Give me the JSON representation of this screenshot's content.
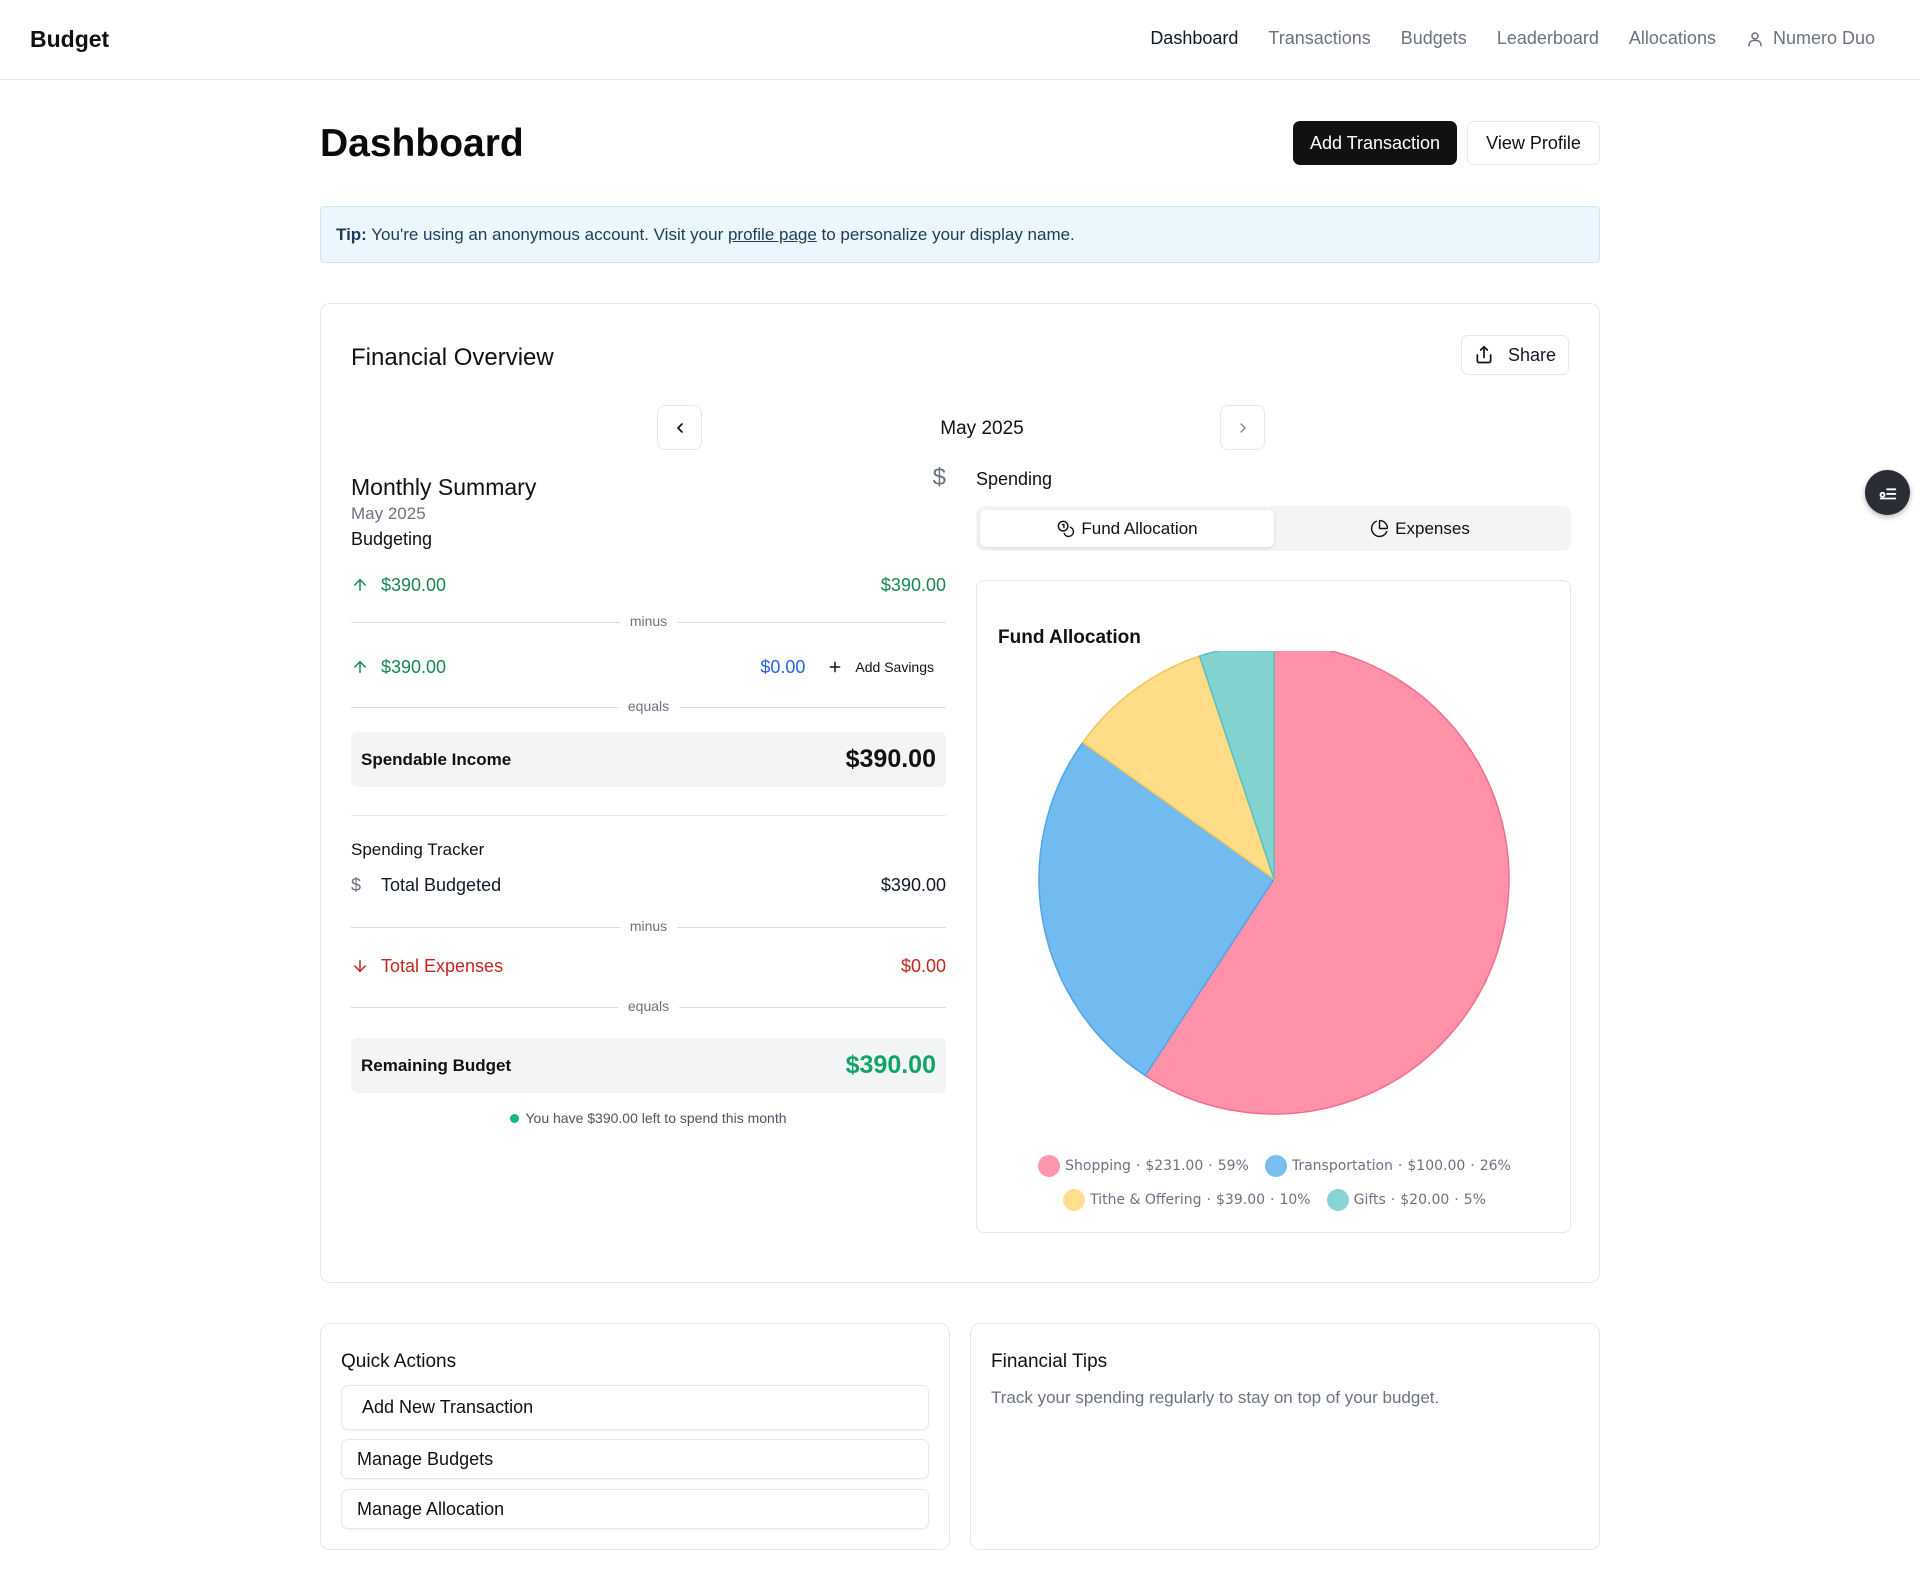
{
  "app": {
    "brand": "Budget"
  },
  "nav": {
    "links": [
      "Dashboard",
      "Transactions",
      "Budgets",
      "Leaderboard",
      "Allocations"
    ],
    "active": "Dashboard",
    "user": "Numero Duo"
  },
  "header": {
    "title": "Dashboard",
    "add_transaction": "Add Transaction",
    "view_profile": "View Profile"
  },
  "tip": {
    "label": "Tip:",
    "text_before": " You're using an anonymous account. Visit your ",
    "link": "profile page",
    "text_after": " to personalize your display name."
  },
  "overview": {
    "title": "Financial Overview",
    "share": "Share",
    "month": "May 2025",
    "summary": {
      "title": "Monthly Summary",
      "currency_symbol": "$",
      "month": "May 2025",
      "subtitle": "Budgeting",
      "income_left": "$390.00",
      "income_right": "$390.00",
      "minus": "minus",
      "savings_left": "$390.00",
      "savings_value": "$0.00",
      "add_savings": "Add Savings",
      "equals": "equals",
      "spendable_label": "Spendable Income",
      "spendable_value": "$390.00"
    },
    "tracker": {
      "title": "Spending Tracker",
      "currency_symbol": "$",
      "budgeted_label": "Total Budgeted",
      "budgeted_value": "$390.00",
      "minus": "minus",
      "expenses_label": "Total Expenses",
      "expenses_value": "$0.00",
      "equals": "equals",
      "remaining_label": "Remaining Budget",
      "remaining_value": "$390.00",
      "note": "You have $390.00 left to spend this month"
    },
    "spending": {
      "label": "Spending",
      "tabs": [
        "Fund Allocation",
        "Expenses"
      ],
      "active_tab": "Fund Allocation"
    }
  },
  "chart_data": {
    "type": "pie",
    "title": "Fund Allocation",
    "categories": [
      "Shopping",
      "Transportation",
      "Tithe & Offering",
      "Gifts"
    ],
    "values": [
      231,
      100,
      39,
      20
    ],
    "amount_labels": [
      "$231.00",
      "$100.00",
      "$39.00",
      "$20.00"
    ],
    "percent_labels": [
      "59%",
      "26%",
      "10%",
      "5%"
    ],
    "colors": [
      "#ff91a8",
      "#71bbf0",
      "#ffdc87",
      "#82d2d2"
    ],
    "legend_position": "bottom"
  },
  "quick_actions": {
    "title": "Quick Actions",
    "buttons": [
      "Add New Transaction",
      "Manage Budgets",
      "Manage Allocation"
    ]
  },
  "financial_tips": {
    "title": "Financial Tips",
    "text": "Track your spending regularly to stay on top of your budget."
  }
}
